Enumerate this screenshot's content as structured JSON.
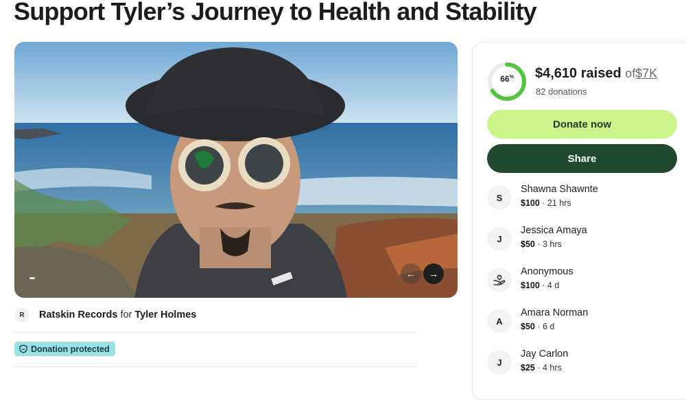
{
  "page_title": "Support Tyler’s Journey to Health and Stability",
  "organizer": {
    "avatar_initial": "R",
    "name": "Ratskin Records",
    "connector": "for",
    "beneficiary": "Tyler Holmes"
  },
  "protection_badge": {
    "label": "Donation protected",
    "icon": "shield-icon",
    "color": "#9ce0e3"
  },
  "carousel": {
    "prev_icon": "arrow-left-icon",
    "next_icon": "arrow-right-icon"
  },
  "fundraiser": {
    "percent_label": "66",
    "percent_sign": "%",
    "progress_fraction": 0.66,
    "raised": "$4,610 raised",
    "of_label": "of",
    "goal": "$7K",
    "donation_count": "82 donations",
    "ring_color": "#56c443"
  },
  "actions": {
    "donate_label": "Donate now",
    "share_label": "Share",
    "donate_color": "#cdf48a",
    "share_color": "#1f4a2f"
  },
  "donations": [
    {
      "initial": "S",
      "name": "Shawna Shawnte",
      "amount": "$100",
      "sep": " · ",
      "time": "21 hrs"
    },
    {
      "initial": "J",
      "name": "Jessica Amaya",
      "amount": "$50",
      "sep": " · ",
      "time": "3 hrs"
    },
    {
      "icon": "heart-hand-icon",
      "name": "Anonymous",
      "amount": "$100",
      "sep": " · ",
      "time": "4 d"
    },
    {
      "initial": "A",
      "name": "Amara Norman",
      "amount": "$50",
      "sep": " · ",
      "time": "6 d"
    },
    {
      "initial": "J",
      "name": "Jay Carlon",
      "amount": "$25",
      "sep": " · ",
      "time": "4 hrs"
    }
  ]
}
